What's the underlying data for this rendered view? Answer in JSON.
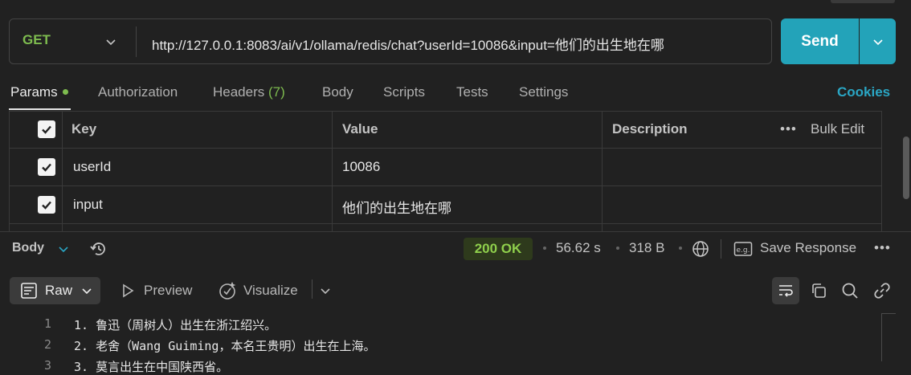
{
  "request": {
    "method": "GET",
    "url": "http://127.0.0.1:8083/ai/v1/ollama/redis/chat?userId=10086&input=他们的出生地在哪",
    "send_label": "Send"
  },
  "tabs": [
    {
      "label": "Params",
      "active": true,
      "has_dot": true
    },
    {
      "label": "Authorization"
    },
    {
      "label": "Headers",
      "count": "(7)"
    },
    {
      "label": "Body"
    },
    {
      "label": "Scripts"
    },
    {
      "label": "Tests"
    },
    {
      "label": "Settings"
    }
  ],
  "cookies_label": "Cookies",
  "params_table": {
    "headers": {
      "key": "Key",
      "value": "Value",
      "description": "Description",
      "bulk_edit": "Bulk Edit"
    },
    "rows": [
      {
        "key": "userId",
        "value": "10086",
        "description": "",
        "checked": true
      },
      {
        "key": "input",
        "value": "他们的出生地在哪",
        "description": "",
        "checked": true
      }
    ]
  },
  "response": {
    "body_label": "Body",
    "status": "200 OK",
    "time": "56.62 s",
    "size": "318 B",
    "save_label": "Save Response",
    "status_color": "#8fcf4c"
  },
  "view_toolbar": {
    "raw_label": "Raw",
    "preview_label": "Preview",
    "visualize_label": "Visualize"
  },
  "response_lines": [
    {
      "num": "1",
      "text": "1. 鲁迅（周树人）出生在浙江绍兴。"
    },
    {
      "num": "2",
      "text": "2. 老舍（Wang Guiming，本名王贵明）出生在上海。"
    },
    {
      "num": "3",
      "text": "3. 莫言出生在中国陕西省。"
    }
  ],
  "colors": {
    "accent": "#23a3b9",
    "background": "#212121",
    "method": "#7ebc4f",
    "cookies": "#2aa6c4"
  }
}
